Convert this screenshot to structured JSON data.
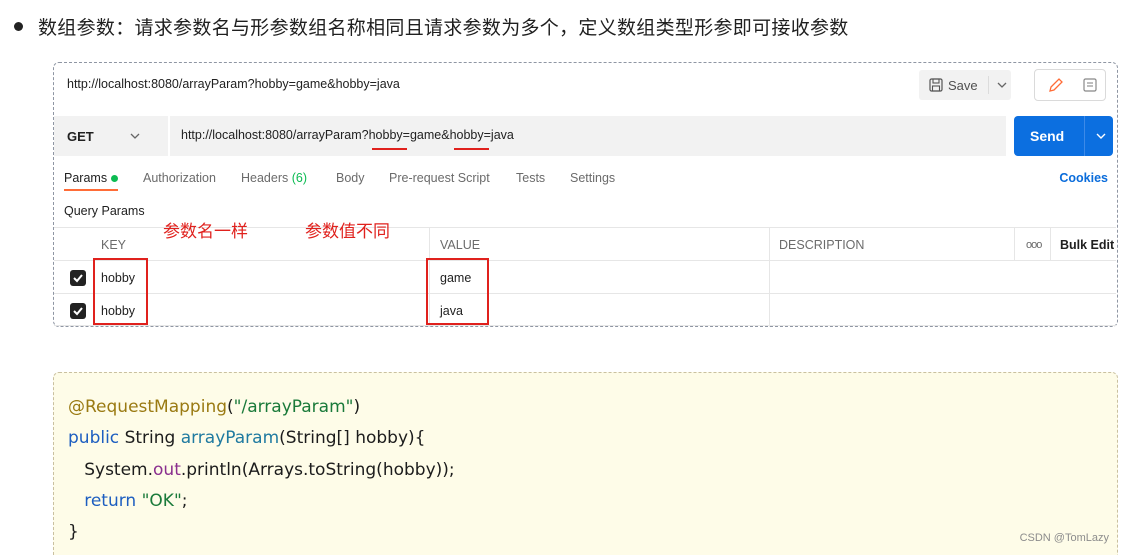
{
  "heading": "数组参数：请求参数名与形参数组名称相同且请求参数为多个，定义数组类型形参即可接收参数",
  "postman": {
    "title_url": "http://localhost:8080/arrayParam?hobby=game&hobby=java",
    "save_label": "Save",
    "method": "GET",
    "request_url": "http://localhost:8080/arrayParam?hobby=game&hobby=java",
    "send_label": "Send",
    "tabs": [
      {
        "label": "Params",
        "active": true
      },
      {
        "label": "Authorization"
      },
      {
        "label": "Headers",
        "count": "(6)"
      },
      {
        "label": "Body"
      },
      {
        "label": "Pre-request Script"
      },
      {
        "label": "Tests"
      },
      {
        "label": "Settings"
      }
    ],
    "cookies_label": "Cookies",
    "query_params_label": "Query Params",
    "columns": {
      "key": "KEY",
      "value": "VALUE",
      "description": "DESCRIPTION",
      "more": "ooo",
      "bulk_edit": "Bulk Edit"
    },
    "rows": [
      {
        "checked": true,
        "key": "hobby",
        "value": "game",
        "description": ""
      },
      {
        "checked": true,
        "key": "hobby",
        "value": "java",
        "description": ""
      }
    ]
  },
  "annotations": {
    "same_name": "参数名一样",
    "diff_value": "参数值不同",
    "color": "#e0211d"
  },
  "code": {
    "l1_anno": "@RequestMapping",
    "l1_open": "(",
    "l1_str": "\"/arrayParam\"",
    "l1_close": ")",
    "l2_public": "public ",
    "l2_type": "String ",
    "l2_method": "arrayParam",
    "l2_sig": "(String[] hobby){",
    "l3_indent": "   System.",
    "l3_out": "out",
    "l3_rest": ".println(Arrays.toString(hobby));",
    "l4_return": "   return ",
    "l4_str": "\"OK\"",
    "l4_semi": ";",
    "l5": "}"
  },
  "watermark": "CSDN @TomLazy"
}
